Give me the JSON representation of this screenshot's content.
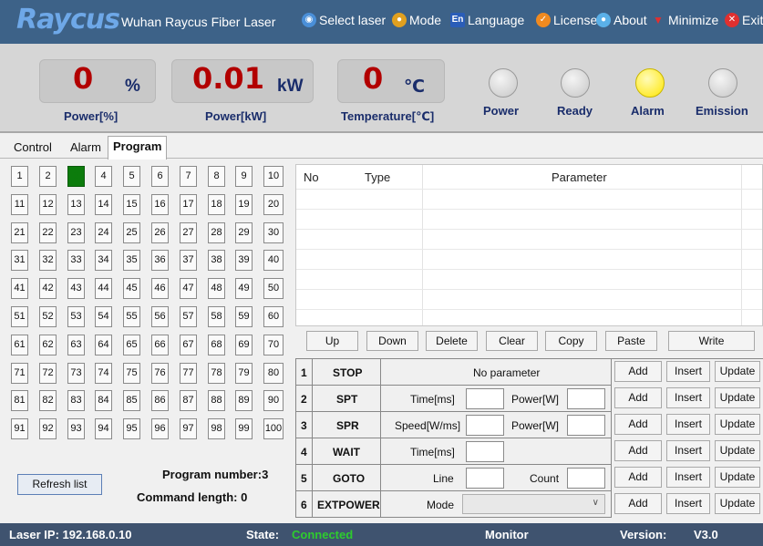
{
  "header": {
    "logo_text": "Raycus",
    "title": "Wuhan Raycus Fiber Laser",
    "menu": [
      {
        "label": "Select laser",
        "icon": "globe-icon"
      },
      {
        "label": "Mode",
        "icon": "users-icon"
      },
      {
        "label": "Language",
        "icon": "en-icon",
        "icon_text": "En"
      },
      {
        "label": "License",
        "icon": "check-icon"
      },
      {
        "label": "About",
        "icon": "globe-icon"
      },
      {
        "label": "Minimize",
        "icon": "minimize-icon"
      },
      {
        "label": "Exit",
        "icon": "close-icon"
      }
    ]
  },
  "readouts": {
    "power_pct": {
      "value": "0",
      "unit": "%",
      "label": "Power[%]"
    },
    "power_kw": {
      "value": "0.01",
      "unit": "kW",
      "label": "Power[kW]"
    },
    "temperature": {
      "value": "0",
      "unit": "℃",
      "label": "Temperature[℃]"
    }
  },
  "lamps": [
    {
      "label": "Power",
      "on": false
    },
    {
      "label": "Ready",
      "on": false
    },
    {
      "label": "Alarm",
      "on": true
    },
    {
      "label": "Emission",
      "on": false
    }
  ],
  "tabs": [
    "Control",
    "Alarm",
    "Program"
  ],
  "active_tab": "Program",
  "program_grid": {
    "numbers": [
      "1",
      "2",
      "3",
      "4",
      "5",
      "6",
      "7",
      "8",
      "9",
      "10",
      "11",
      "12",
      "13",
      "14",
      "15",
      "16",
      "17",
      "18",
      "19",
      "20",
      "21",
      "22",
      "23",
      "24",
      "25",
      "26",
      "27",
      "28",
      "29",
      "30",
      "31",
      "32",
      "33",
      "34",
      "35",
      "36",
      "37",
      "38",
      "39",
      "40",
      "41",
      "42",
      "43",
      "44",
      "45",
      "46",
      "47",
      "48",
      "49",
      "50",
      "51",
      "52",
      "53",
      "54",
      "55",
      "56",
      "57",
      "58",
      "59",
      "60",
      "61",
      "62",
      "63",
      "64",
      "65",
      "66",
      "67",
      "68",
      "69",
      "70",
      "71",
      "72",
      "73",
      "74",
      "75",
      "76",
      "77",
      "78",
      "79",
      "80",
      "81",
      "82",
      "83",
      "84",
      "85",
      "86",
      "87",
      "88",
      "89",
      "90",
      "91",
      "92",
      "93",
      "94",
      "95",
      "96",
      "97",
      "98",
      "99",
      "100"
    ],
    "selected": "3"
  },
  "refresh_label": "Refresh list",
  "program_number_text": "Program number:3",
  "command_length_text": "Command length:  0",
  "command_list": {
    "headers": [
      "No",
      "Type",
      "Parameter"
    ]
  },
  "controls": [
    "Up",
    "Down",
    "Delete",
    "Clear",
    "Copy",
    "Paste",
    "Write"
  ],
  "commands": [
    {
      "num": "1",
      "name": "STOP",
      "text": "No parameter"
    },
    {
      "num": "2",
      "name": "SPT",
      "label1": "Time[ms]",
      "label2": "Power[W]"
    },
    {
      "num": "3",
      "name": "SPR",
      "label1": "Speed[W/ms]",
      "label2": "Power[W]"
    },
    {
      "num": "4",
      "name": "WAIT",
      "label1": "Time[ms]"
    },
    {
      "num": "5",
      "name": "GOTO",
      "label1": "Line",
      "label2": "Count"
    },
    {
      "num": "6",
      "name": "EXTPOWER",
      "label1": "Mode"
    }
  ],
  "row_actions": [
    "Add",
    "Insert",
    "Update"
  ],
  "statusbar": {
    "ip_text": "Laser IP:  192.168.0.10",
    "state_label": "State:",
    "state_value": "Connected",
    "monitor": "Monitor",
    "version_label": "Version:",
    "version_value": "V3.0"
  },
  "colors": {
    "state_connected": "#2ecc2e",
    "readout_value": "#b20000",
    "label_blue": "#1a2d6b",
    "selected_program": "#0c7c0c",
    "lamp_alarm": "#ffe600"
  }
}
